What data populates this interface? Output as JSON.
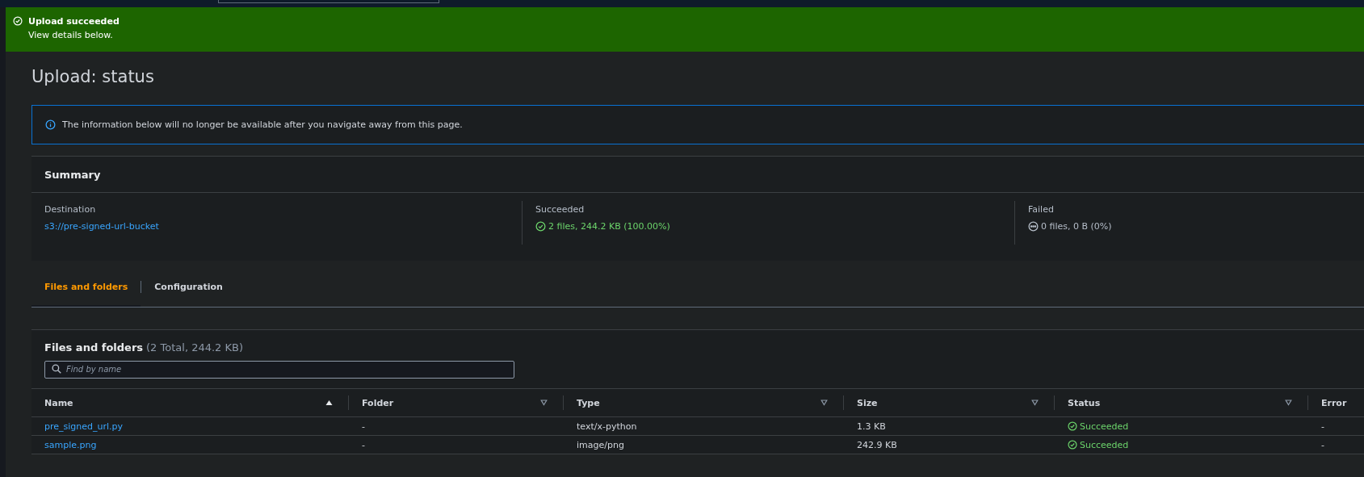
{
  "banner": {
    "title": "Upload succeeded",
    "message": "View details below."
  },
  "page_title": "Upload: status",
  "alert": {
    "text": "The information below will no longer be available after you navigate away from this page."
  },
  "summary": {
    "title": "Summary",
    "items": [
      {
        "label": "Destination",
        "value": "s3://pre-signed-url-bucket",
        "kind": "link"
      },
      {
        "label": "Succeeded",
        "value": "2 files, 244.2 KB (100.00%)",
        "kind": "success"
      },
      {
        "label": "Failed",
        "value": "0 files, 0 B (0%)",
        "kind": "neutral"
      }
    ]
  },
  "tabs": [
    {
      "label": "Files and folders",
      "selected": true
    },
    {
      "label": "Configuration",
      "selected": false
    }
  ],
  "files": {
    "title": "Files and folders",
    "count": "(2 Total, 244.2 KB)",
    "search": {
      "placeholder": "Find by name"
    },
    "columns": [
      {
        "label": "Name",
        "sorted": true
      },
      {
        "label": "Folder",
        "sorted": false
      },
      {
        "label": "Type",
        "sorted": false
      },
      {
        "label": "Size",
        "sorted": false
      },
      {
        "label": "Status",
        "sorted": false
      },
      {
        "label": "Error"
      }
    ],
    "rows": [
      {
        "name": "pre_signed_url.py",
        "folder": "-",
        "type": "text/x-python",
        "size": "1.3 KB",
        "status": "Succeeded",
        "error": "-"
      },
      {
        "name": "sample.png",
        "folder": "-",
        "type": "image/png",
        "size": "242.9 KB",
        "status": "Succeeded",
        "error": "-"
      }
    ]
  }
}
